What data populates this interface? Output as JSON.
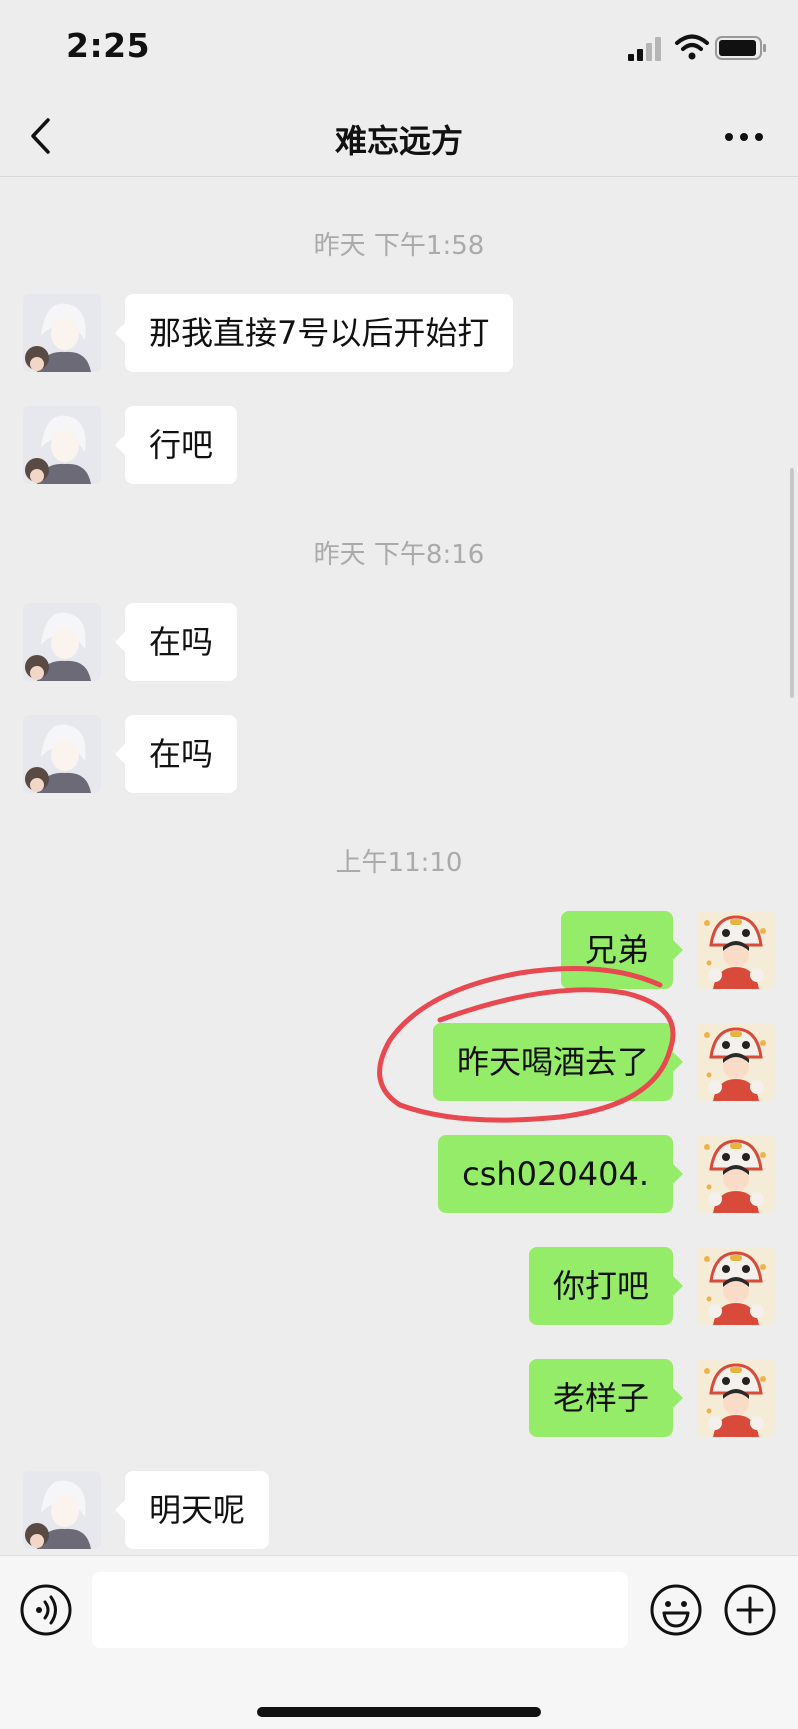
{
  "status_bar": {
    "time": "2:25"
  },
  "nav": {
    "title": "难忘远方"
  },
  "chat": {
    "timestamps": [
      "昨天 下午1:58",
      "昨天 下午8:16",
      "上午11:10"
    ],
    "messages": [
      {
        "side": "left",
        "text": "那我直接7号以后开始打"
      },
      {
        "side": "left",
        "text": "行吧"
      },
      {
        "side": "left",
        "text": "在吗"
      },
      {
        "side": "left",
        "text": "在吗"
      },
      {
        "side": "right",
        "text": "兄弟"
      },
      {
        "side": "right",
        "text": "昨天喝酒去了"
      },
      {
        "side": "right",
        "text": "csh020404."
      },
      {
        "side": "right",
        "text": "你打吧"
      },
      {
        "side": "right",
        "text": "老样子"
      },
      {
        "side": "left",
        "text": "明天呢"
      }
    ]
  },
  "colors": {
    "background": "#ededed",
    "self_bubble": "#95ec69",
    "other_bubble": "#ffffff",
    "annotation": "#e8484f"
  },
  "icons": [
    "back-icon",
    "more-icon",
    "voice-icon",
    "emoji-icon",
    "plus-icon"
  ]
}
